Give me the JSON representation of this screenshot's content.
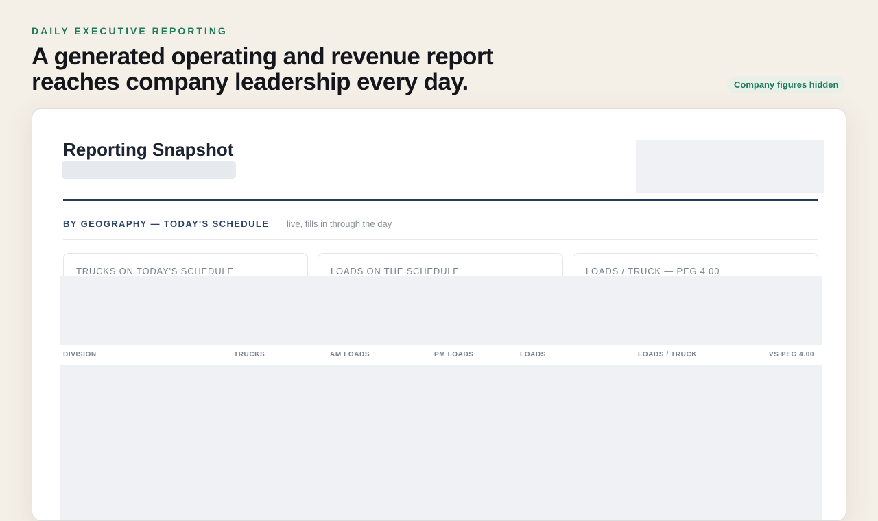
{
  "header": {
    "eyebrow": "DAILY EXECUTIVE REPORTING",
    "headline": "A generated operating and revenue report reaches company leadership every day.",
    "badge": "Company figures hidden"
  },
  "report": {
    "title": "Reporting Snapshot",
    "section": {
      "title": "BY GEOGRAPHY — TODAY'S SCHEDULE",
      "note": "live, fills in through the day"
    },
    "kpis": [
      {
        "label": "TRUCKS ON TODAY'S SCHEDULE"
      },
      {
        "label": "LOADS ON THE SCHEDULE"
      },
      {
        "label": "LOADS / TRUCK — PEG 4.00"
      }
    ],
    "table": {
      "columns": [
        "DIVISION",
        "TRUCKS",
        "AM LOADS",
        "PM LOADS",
        "LOADS",
        "LOADS / TRUCK",
        "VS PEG 4.00"
      ]
    }
  },
  "colors": {
    "accent": "#1f7a55",
    "navy": "#253a55",
    "background": "#f4efe7",
    "mask": "#f0f1f5"
  }
}
